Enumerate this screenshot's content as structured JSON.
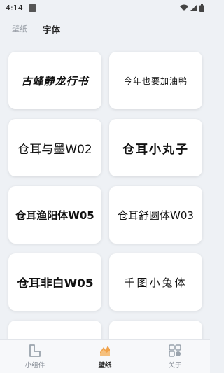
{
  "status_bar": {
    "time": "4:14",
    "icons": [
      "notification-icon",
      "wifi-icon",
      "signal-icon",
      "battery-icon"
    ]
  },
  "top_tabs": [
    {
      "label": "壁纸",
      "active": false
    },
    {
      "label": "字体",
      "active": true
    }
  ],
  "fonts": [
    {
      "label": "古峰静龙行书"
    },
    {
      "label": "今年也要加油鸭"
    },
    {
      "label": "仓耳与墨W02"
    },
    {
      "label": "仓耳小丸子"
    },
    {
      "label": "仓耳渔阳体W05"
    },
    {
      "label": "仓耳舒圆体W03"
    },
    {
      "label": "仓耳非白W05"
    },
    {
      "label": "千图小兔体"
    }
  ],
  "bottom_nav": [
    {
      "label": "小组件",
      "icon": "widget-icon",
      "active": false
    },
    {
      "label": "壁纸",
      "icon": "wallpaper-icon",
      "active": true
    },
    {
      "label": "关于",
      "icon": "about-icon",
      "active": false
    }
  ],
  "colors": {
    "background": "#eef1f5",
    "card": "#ffffff",
    "active_icon": "#f0a24a",
    "inactive_icon": "#9aa3ad"
  }
}
